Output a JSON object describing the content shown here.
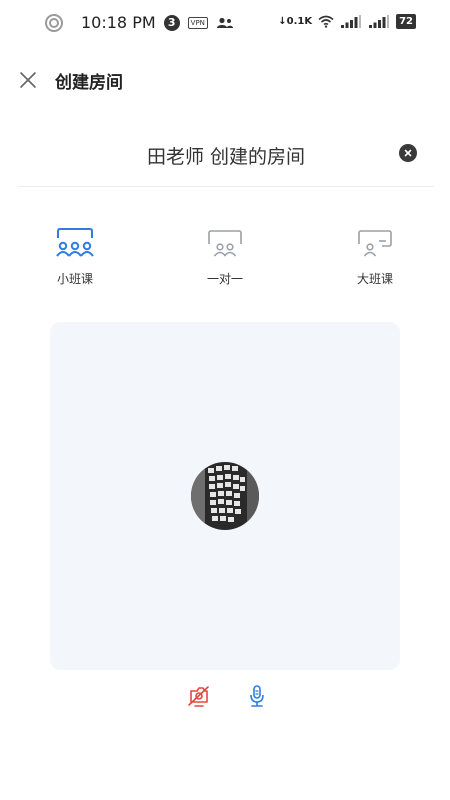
{
  "status_bar": {
    "time": "10:18 PM",
    "notification_count": "3",
    "vpn_label": "VPN",
    "network_speed": "0.1K",
    "battery": "72"
  },
  "header": {
    "title": "创建房间",
    "close_icon": "close-icon"
  },
  "room": {
    "name": "田老师 创建的房间",
    "clear_icon": "clear-icon"
  },
  "modes": [
    {
      "label": "小班课",
      "icon": "small-class-icon",
      "selected": true
    },
    {
      "label": "一对一",
      "icon": "one-on-one-icon",
      "selected": false
    },
    {
      "label": "大班课",
      "icon": "large-class-icon",
      "selected": false
    }
  ],
  "colors": {
    "accent": "#2f7de1",
    "inactive": "#9aa0a8",
    "camera_off": "#e04a3c",
    "preview_bg": "#f3f7fc"
  },
  "controls": {
    "camera": "camera-off-icon",
    "mic": "microphone-icon"
  }
}
